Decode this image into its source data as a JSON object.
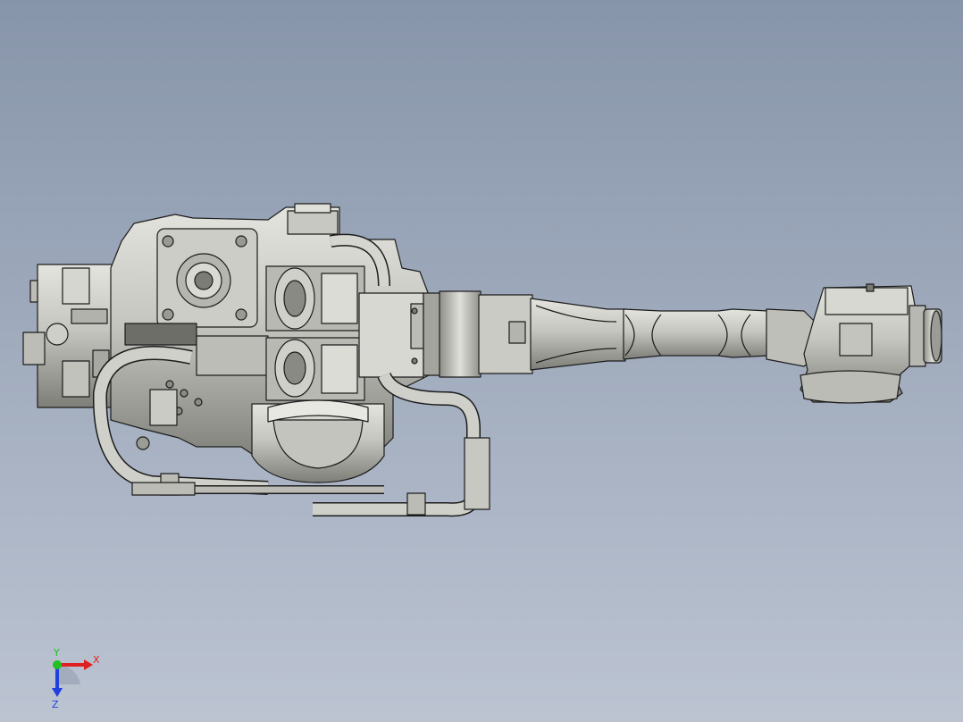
{
  "viewport": {
    "background_top": "#8795aa",
    "background_bottom": "#bcc4d2",
    "model_name": "",
    "model_fill": "#c9c9c3",
    "model_shade": "#8e8e88",
    "edge_color": "#1c1c1c"
  },
  "triad": {
    "x_label": "X",
    "y_label": "Y",
    "z_label": "Z",
    "x_color": "#e02020",
    "y_color": "#20c020",
    "z_color": "#2040e0"
  }
}
